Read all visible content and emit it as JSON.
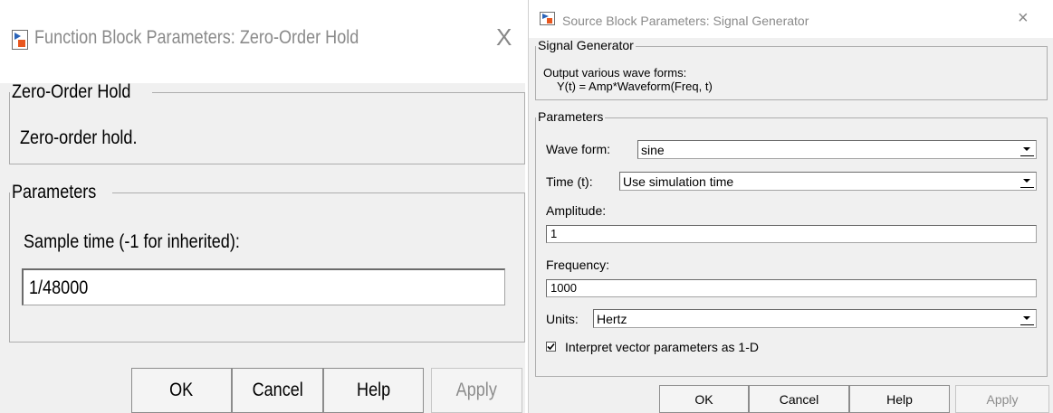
{
  "left_dialog": {
    "title": "Function Block Parameters: Zero-Order Hold",
    "block_group": {
      "legend": "Zero-Order Hold",
      "description": "Zero-order hold."
    },
    "params_group": {
      "legend": "Parameters",
      "sample_time_label": "Sample time (-1 for inherited):",
      "sample_time_value": "1/48000"
    },
    "buttons": {
      "ok": "OK",
      "cancel": "Cancel",
      "help": "Help",
      "apply": "Apply"
    },
    "close_glyph": "X"
  },
  "right_dialog": {
    "title": "Source Block Parameters: Signal Generator",
    "block_group": {
      "legend": "Signal Generator",
      "description_line1": "Output various wave forms:",
      "description_line2": "Y(t) = Amp*Waveform(Freq, t)"
    },
    "params_group": {
      "legend": "Parameters",
      "wave_form_label": "Wave form:",
      "wave_form_value": "sine",
      "time_label": "Time (t):",
      "time_value": "Use simulation time",
      "amplitude_label": "Amplitude:",
      "amplitude_value": "1",
      "frequency_label": "Frequency:",
      "frequency_value": "1000",
      "units_label": "Units:",
      "units_value": "Hertz",
      "interpret_label": "Interpret vector parameters as 1-D",
      "interpret_checked": true
    },
    "buttons": {
      "ok": "OK",
      "cancel": "Cancel",
      "help": "Help",
      "apply": "Apply"
    },
    "close_glyph": "×"
  },
  "colors": {
    "dialog_bg": "#f0f0f0",
    "title_text": "#8a8a8a",
    "group_border": "#adadad",
    "icon_red": "#e8561e",
    "icon_blue": "#2a63b8"
  }
}
